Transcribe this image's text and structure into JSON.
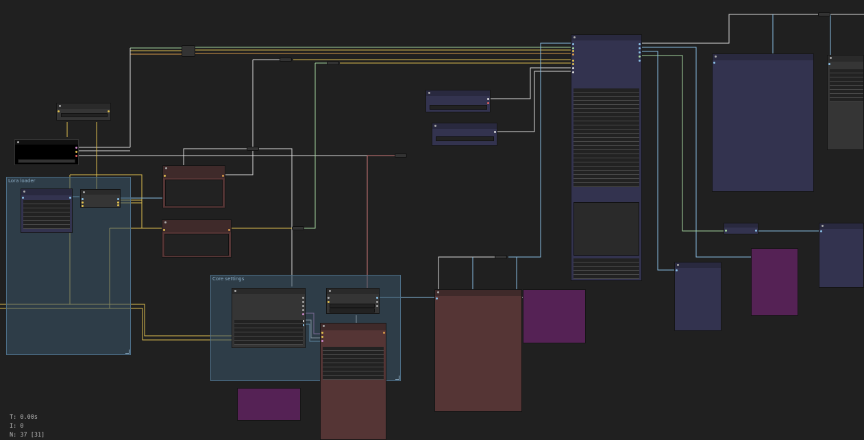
{
  "groups": [
    {
      "id": "lora",
      "title": "Lora loader"
    },
    {
      "id": "core",
      "title": "Core settings"
    }
  ],
  "stats": {
    "time": "T: 0.00s",
    "iterations": "I: 0",
    "nodes": "N: 37 [31]"
  },
  "colors": {
    "background": "#202020",
    "group_fill": "#3a566a",
    "link_yellow": "#e0c050",
    "link_blue": "#8ac0e6",
    "link_green": "#a6d8a0",
    "link_red": "#d07a7a",
    "link_white": "#dddddd",
    "link_orange": "#d89a4a",
    "node_gray": "#353535",
    "node_blue": "#33334f",
    "node_red": "#553535",
    "node_purple": "#552255"
  }
}
